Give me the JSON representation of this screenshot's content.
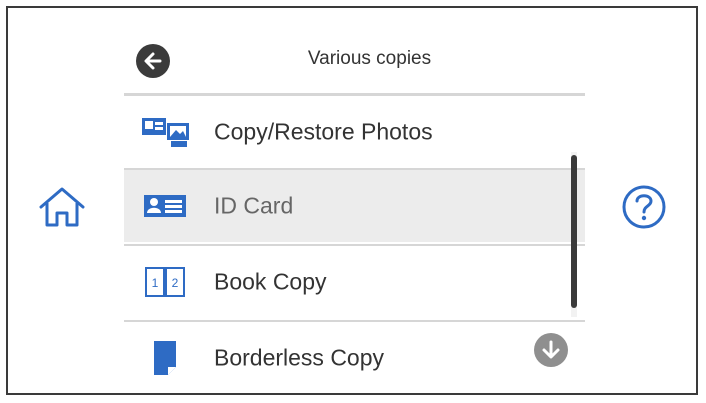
{
  "header": {
    "title": "Various copies",
    "back_icon": "arrow-left-circle-icon"
  },
  "menu": {
    "items": [
      {
        "label": "Copy/Restore Photos",
        "icon": "photos-icon",
        "selected": false
      },
      {
        "label": "ID Card",
        "icon": "id-card-icon",
        "selected": true
      },
      {
        "label": "Book Copy",
        "icon": "book-pages-icon",
        "selected": false,
        "page_numbers": [
          "1",
          "2"
        ]
      },
      {
        "label": "Borderless Copy",
        "icon": "borderless-page-icon",
        "selected": false
      }
    ]
  },
  "nav": {
    "home_icon": "home-icon",
    "help_icon": "question-circle-icon",
    "scroll_down_icon": "arrow-down-circle-icon"
  },
  "colors": {
    "accent_blue": "#2e6bc4",
    "dark": "#3b3b3b",
    "selected_bg": "#ececec",
    "divider": "#d6d6d6"
  }
}
